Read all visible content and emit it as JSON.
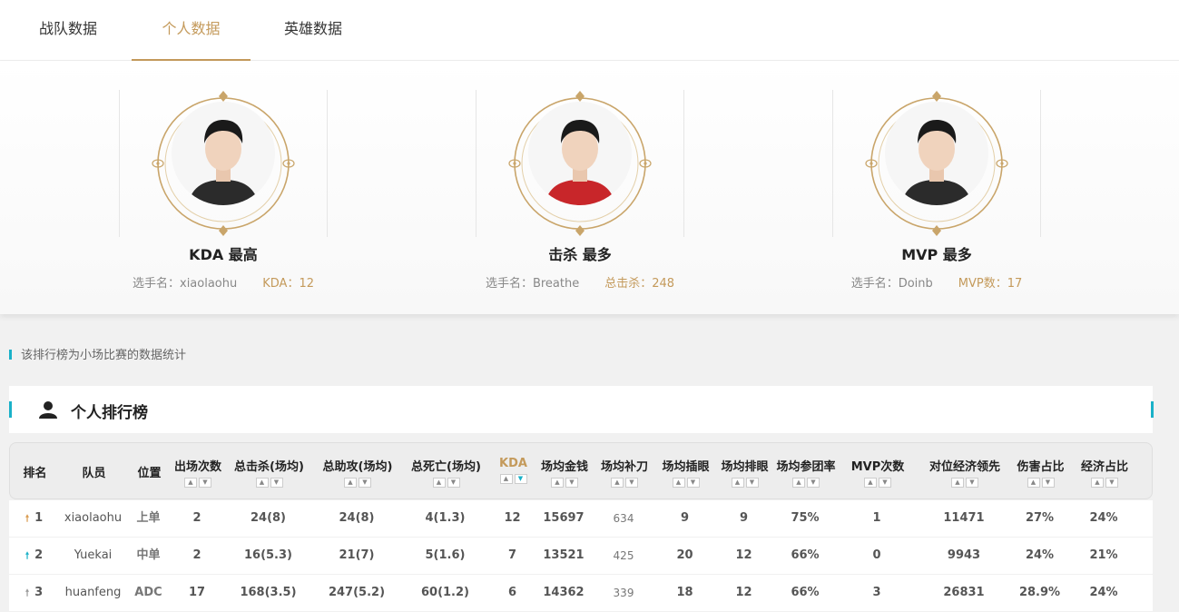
{
  "tabs": [
    "战队数据",
    "个人数据",
    "英雄数据"
  ],
  "active_tab": "个人数据",
  "accent_color": "#c49a5b",
  "highlight_color": "#1ab1c8",
  "highlights": [
    {
      "title": "KDA 最高",
      "player_label": "选手名：xiaolaohu",
      "stat_label": "KDA：12",
      "jersey_color": "#2b2b2b"
    },
    {
      "title": "击杀 最多",
      "player_label": "选手名：Breathe",
      "stat_label": "总击杀：248",
      "jersey_color": "#c8262a"
    },
    {
      "title": "MVP 最多",
      "player_label": "选手名：Doinb",
      "stat_label": "MVP数：17",
      "jersey_color": "#2b2b2b"
    }
  ],
  "note": "该排行榜为小场比赛的数据统计",
  "ranking": {
    "title": "个人排行榜",
    "icon": "user-icon",
    "columns": [
      "排名",
      "队员",
      "位置",
      "出场次数",
      "总击杀(场均)",
      "总助攻(场均)",
      "总死亡(场均)",
      "KDA",
      "场均金钱",
      "场均补刀",
      "场均插眼",
      "场均排眼",
      "场均参团率",
      "MVP次数",
      "对位经济领先",
      "伤害占比",
      "经济占比"
    ],
    "sort_up": "▲",
    "sort_down": "▼",
    "rows": [
      {
        "rank": "1",
        "trend": "up",
        "trend_color": "#d99a4e",
        "player": "xiaolaohu",
        "position": "上单",
        "games": "2",
        "kills": "24(8)",
        "assists": "24(8)",
        "deaths": "4(1.3)",
        "kda": "12",
        "gold": "15697",
        "cs": "634",
        "wards": "9",
        "wards_cleared": "9",
        "kp": "75%",
        "mvp": "1",
        "gold_diff": "11471",
        "dmg_share": "27%",
        "gold_share": "24%"
      },
      {
        "rank": "2",
        "trend": "up",
        "trend_color": "#1ab1c8",
        "player": "Yuekai",
        "position": "中单",
        "games": "2",
        "kills": "16(5.3)",
        "assists": "21(7)",
        "deaths": "5(1.6)",
        "kda": "7",
        "gold": "13521",
        "cs": "425",
        "wards": "20",
        "wards_cleared": "12",
        "kp": "66%",
        "mvp": "0",
        "gold_diff": "9943",
        "dmg_share": "24%",
        "gold_share": "21%"
      },
      {
        "rank": "3",
        "trend": "up",
        "trend_color": "#999999",
        "player": "huanfeng",
        "position": "ADC",
        "games": "17",
        "kills": "168(3.5)",
        "assists": "247(5.2)",
        "deaths": "60(1.2)",
        "kda": "6",
        "gold": "14362",
        "cs": "339",
        "wards": "18",
        "wards_cleared": "12",
        "kp": "66%",
        "mvp": "3",
        "gold_diff": "26831",
        "dmg_share": "28.9%",
        "gold_share": "24%"
      }
    ]
  }
}
